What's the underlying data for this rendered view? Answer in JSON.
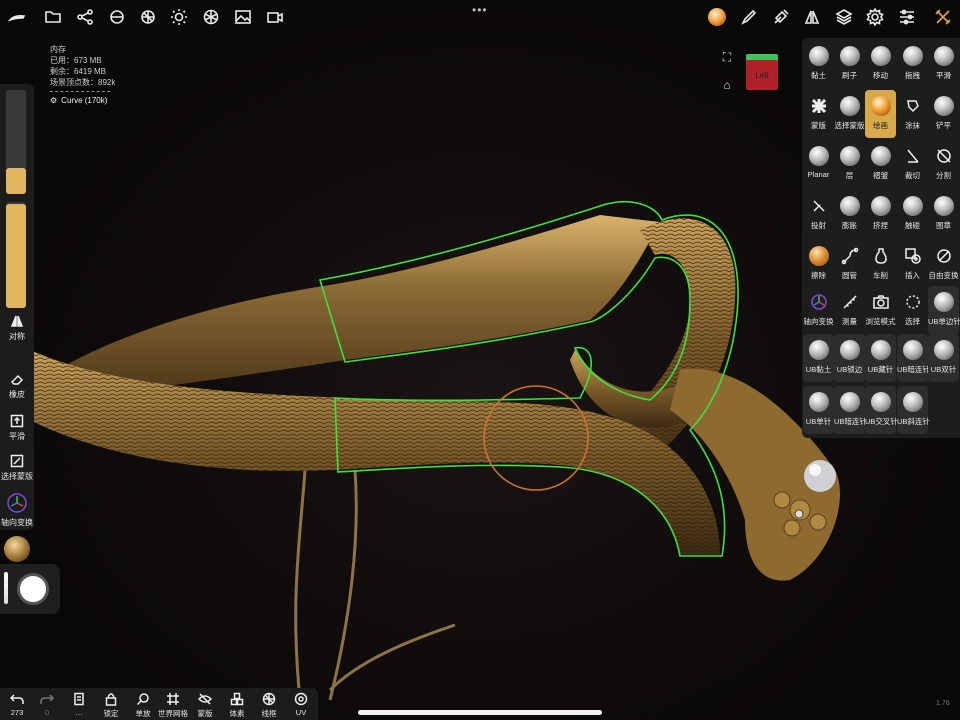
{
  "topbar": {
    "icons": [
      "brush-logo-icon",
      "folder-icon",
      "share-icon",
      "scene-icon",
      "grid-sphere-icon",
      "light-icon",
      "material-icon",
      "image-icon",
      "video-icon"
    ],
    "right_icons": [
      "brush-pen-icon",
      "eyedropper-icon",
      "symmetry-icon",
      "layers-icon",
      "settings-icon",
      "sliders-icon",
      "tools-icon"
    ],
    "accent": "#d8a94b"
  },
  "stats": {
    "title": "内存",
    "used": "已用：673 MB",
    "free": "剩余：6419 MB",
    "vertices": "场景顶点数：892k",
    "mesh_name": "Curve (170k)"
  },
  "navcube": {
    "label": "Left"
  },
  "left_sidebar": {
    "symmetry": "对称",
    "eraser": "橡皮",
    "smooth": "平滑",
    "select_mask": "选择蒙版",
    "gizmo": "轴向变换",
    "radius_level": 0.18,
    "intensity_level": 0.5
  },
  "tools": [
    {
      "label": "黏土"
    },
    {
      "label": "刷子"
    },
    {
      "label": "移动"
    },
    {
      "label": "拖拽"
    },
    {
      "label": "平滑"
    },
    {
      "label": "蒙版"
    },
    {
      "label": "选择蒙版"
    },
    {
      "label": "绘画"
    },
    {
      "label": "涂抹"
    },
    {
      "label": "铲平"
    },
    {
      "label": "Planar"
    },
    {
      "label": "层"
    },
    {
      "label": "褶皱"
    },
    {
      "label": "裁切"
    },
    {
      "label": "分割"
    },
    {
      "label": "投射"
    },
    {
      "label": "膨胀"
    },
    {
      "label": "挤捏"
    },
    {
      "label": "触碰"
    },
    {
      "label": "图章"
    },
    {
      "label": "擦除"
    },
    {
      "label": "圆管"
    },
    {
      "label": "车削"
    },
    {
      "label": "插入"
    },
    {
      "label": "自由变换"
    },
    {
      "label": "轴向变换"
    },
    {
      "label": "测量"
    },
    {
      "label": "浏览模式"
    },
    {
      "label": "选择"
    },
    {
      "label": "UB单边针"
    },
    {
      "label": "UB黏土"
    },
    {
      "label": "UB锁边"
    },
    {
      "label": "UB藏针"
    },
    {
      "label": "UB暗连针"
    },
    {
      "label": "UB双针"
    },
    {
      "label": "UB单针"
    },
    {
      "label": "UB暗连针"
    },
    {
      "label": "UB交叉针"
    },
    {
      "label": "UB斜连针"
    }
  ],
  "active_tool": "绘画",
  "bottombar": {
    "undo_count": "273",
    "redo_count": "0",
    "items": [
      "锁定",
      "单放",
      "世界网格",
      "蒙版",
      "体素",
      "线框",
      "UV"
    ]
  },
  "version": "1.76"
}
